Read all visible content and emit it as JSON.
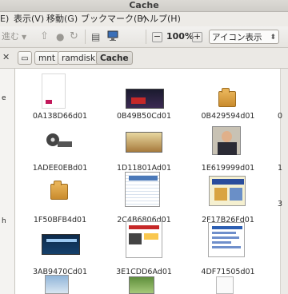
{
  "window": {
    "title": "Cache"
  },
  "menu": {
    "edit": "E)",
    "view": "表示(V)",
    "go": "移動(G)",
    "bookmarks": "ブックマーク(B)",
    "help": "ヘルプ(H)"
  },
  "toolbar": {
    "forward": "進む",
    "zoom": "100%",
    "view_mode": "アイコン表示"
  },
  "location": {
    "crumbs": [
      "mnt",
      "ramdisk",
      "Cache"
    ]
  },
  "files": [
    {
      "name": "0A138D66d01"
    },
    {
      "name": "0B49B50Cd01"
    },
    {
      "name": "0B429594d01"
    },
    {
      "name": "1ADEE0EBd01"
    },
    {
      "name": "1D11801Ad01"
    },
    {
      "name": "1E619999d01"
    },
    {
      "name": "1F50BFB4d01"
    },
    {
      "name": "2C4B6806d01"
    },
    {
      "name": "2F17B26Fd01"
    },
    {
      "name": "3AB9470Cd01"
    },
    {
      "name": "3E1CDD6Ad01"
    },
    {
      "name": "4DF71505d01"
    }
  ],
  "partial_right": {
    "row1": "0",
    "row2": "1",
    "row3": "3"
  },
  "colors": {
    "selection": "#f07746",
    "folder": "#d99a3a",
    "toolbar_bg": "#e6e4e0"
  }
}
